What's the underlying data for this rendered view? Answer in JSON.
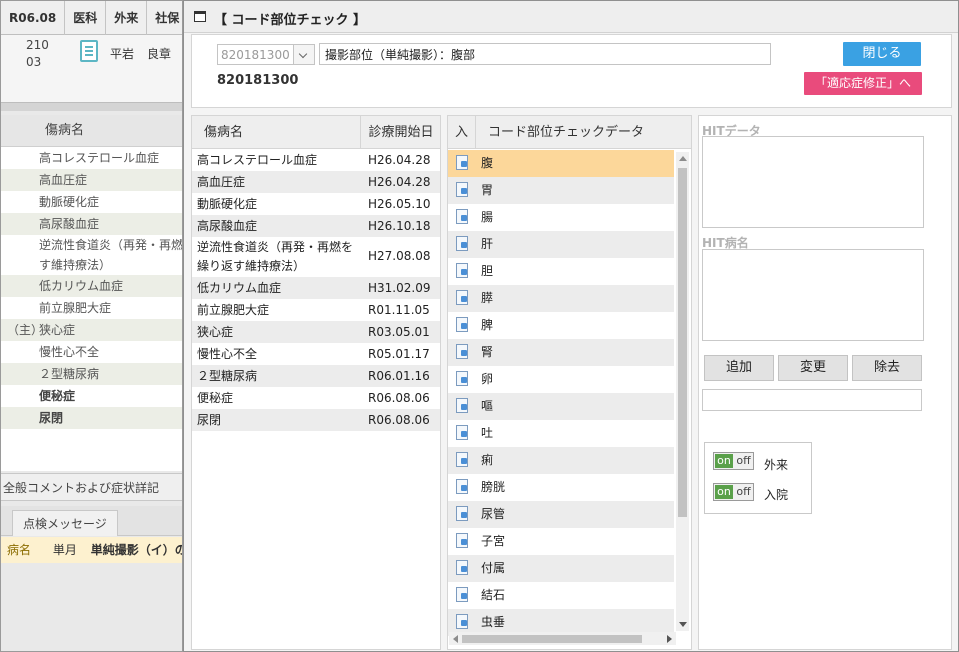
{
  "background": {
    "tabs": [
      "R06.08",
      "医科",
      "外来",
      "社保"
    ],
    "info": {
      "num1": "210",
      "num2": "03",
      "doctor1": "平岩",
      "doctor2": "良章"
    },
    "list_header": "傷病名",
    "diseases": [
      {
        "prefix": "",
        "name": "高コレステロール血症"
      },
      {
        "prefix": "",
        "name": "高血圧症"
      },
      {
        "prefix": "",
        "name": "動脈硬化症"
      },
      {
        "prefix": "",
        "name": "高尿酸血症"
      },
      {
        "prefix": "",
        "name": "逆流性食道炎（再発・再燃す維持療法）"
      },
      {
        "prefix": "",
        "name": "低カリウム血症"
      },
      {
        "prefix": "",
        "name": "前立腺肥大症"
      },
      {
        "prefix": "（主）",
        "name": "狭心症"
      },
      {
        "prefix": "",
        "name": "慢性心不全"
      },
      {
        "prefix": "",
        "name": "２型糖尿病"
      },
      {
        "prefix": "",
        "name": "便秘症"
      },
      {
        "prefix": "",
        "name": "尿閉"
      }
    ],
    "comment_header": "全般コメントおよび症状詳記",
    "message_tab": "点検メッセージ",
    "message": {
      "col1": "病名",
      "col2": "単月",
      "col3": "単純撮影（イ）の"
    }
  },
  "dialog": {
    "title": "【 コード部位チェック 】",
    "code_select": "820181300",
    "name_value": "撮影部位（単純撮影）：腹部",
    "code_text": "820181300",
    "close_button": "閉じる",
    "fix_button": "「適応症修正」へ",
    "disease_table": {
      "headers": [
        "傷病名",
        "診療開始日"
      ],
      "rows": [
        {
          "name": "高コレステロール血症",
          "date": "H26.04.28"
        },
        {
          "name": "高血圧症",
          "date": "H26.04.28"
        },
        {
          "name": "動脈硬化症",
          "date": "H26.05.10"
        },
        {
          "name": "高尿酸血症",
          "date": "H26.10.18"
        },
        {
          "name": "逆流性食道炎（再発・再燃を繰り返す維持療法）",
          "date": "H27.08.08"
        },
        {
          "name": "低カリウム血症",
          "date": "H31.02.09"
        },
        {
          "name": "前立腺肥大症",
          "date": "R01.11.05"
        },
        {
          "name": "狭心症",
          "date": "R03.05.01"
        },
        {
          "name": "慢性心不全",
          "date": "R05.01.17"
        },
        {
          "name": "２型糖尿病",
          "date": "R06.01.16"
        },
        {
          "name": "便秘症",
          "date": "R06.08.06"
        },
        {
          "name": "尿閉",
          "date": "R06.08.06"
        }
      ]
    },
    "code_table": {
      "headers": [
        "入",
        "コード部位チェックデータ"
      ],
      "rows": [
        "腹",
        "胃",
        "腸",
        "肝",
        "胆",
        "膵",
        "脾",
        "腎",
        "卵",
        "嘔",
        "吐",
        "痢",
        "膀胱",
        "尿管",
        "子宮",
        "付属",
        "結石",
        "虫垂"
      ],
      "selected_index": 0
    },
    "hit": {
      "data_label": "HITデータ",
      "name_label": "HIT病名",
      "add_button": "追加",
      "change_button": "変更",
      "remove_button": "除去",
      "toggle_on": "on",
      "toggle_off": "off",
      "outpatient_label": "外来",
      "inpatient_label": "入院"
    }
  }
}
